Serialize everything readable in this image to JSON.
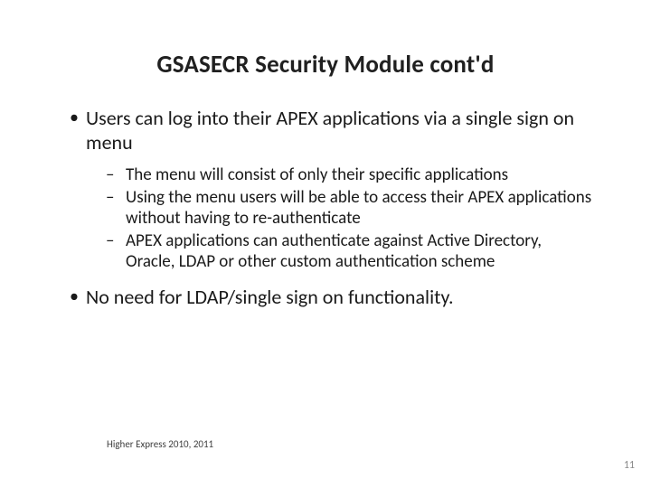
{
  "title": "GSASECR Security Module cont'd",
  "bullets": [
    {
      "text": "Users can log into their APEX applications via a single sign on menu",
      "sub": [
        "The menu will consist of only their specific applications",
        "Using the menu users will be able to access their APEX applications without having to re-authenticate",
        "APEX applications can authenticate against Active Directory,  Oracle,  LDAP or other custom authentication scheme"
      ]
    },
    {
      "text": "No need for LDAP/single sign on functionality.",
      "sub": []
    }
  ],
  "footer": "Higher Express 2010, 2011",
  "page_number": "11"
}
